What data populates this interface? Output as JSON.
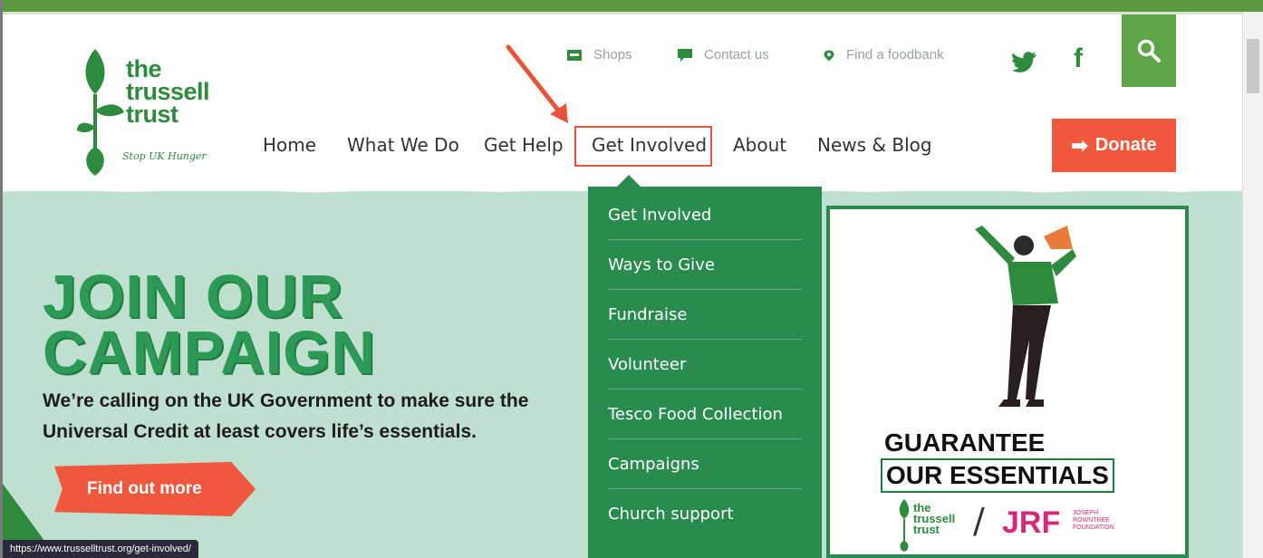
{
  "utility_nav": {
    "shops": "Shops",
    "contact": "Contact us",
    "find_foodbank": "Find a foodbank"
  },
  "logo": {
    "name_lines": [
      "the",
      "trussell",
      "trust"
    ],
    "tagline": "Stop UK Hunger"
  },
  "main_nav": {
    "items": [
      "Home",
      "What We Do",
      "Get Help",
      "Get Involved",
      "About",
      "News & Blog"
    ],
    "active": "Get Involved"
  },
  "donate_label": "Donate",
  "hero": {
    "title_lines": [
      "JOIN OUR",
      "CAMPAIGN"
    ],
    "body_lines": [
      "We’re calling on the UK Government to make sure the",
      "Universal Credit at least covers life’s essentials."
    ],
    "cta_label": "Find out more"
  },
  "dropdown": {
    "items": [
      "Get Involved",
      "Ways to Give",
      "Fundraise",
      "Volunteer",
      "Tesco Food Collection",
      "Campaigns",
      "Church support"
    ]
  },
  "poster": {
    "title_lines": [
      "GUARANTEE",
      "OUR ESSENTIALS"
    ],
    "partner_logo_lines": [
      "the",
      "trussell",
      "trust"
    ],
    "partner": "JRF",
    "partner_sub": [
      "JOSEPH",
      "ROWNTREE",
      "FOUNDATION"
    ]
  },
  "status_url": "https://www.trusselltrust.org/get-involved/",
  "colors": {
    "brand_green": "#2e8b3e",
    "accent_orange": "#f0583d",
    "hero_bg": "#bfdfcf",
    "dropdown_bg": "#2a8b4f",
    "annotation_red": "#e6553a"
  }
}
